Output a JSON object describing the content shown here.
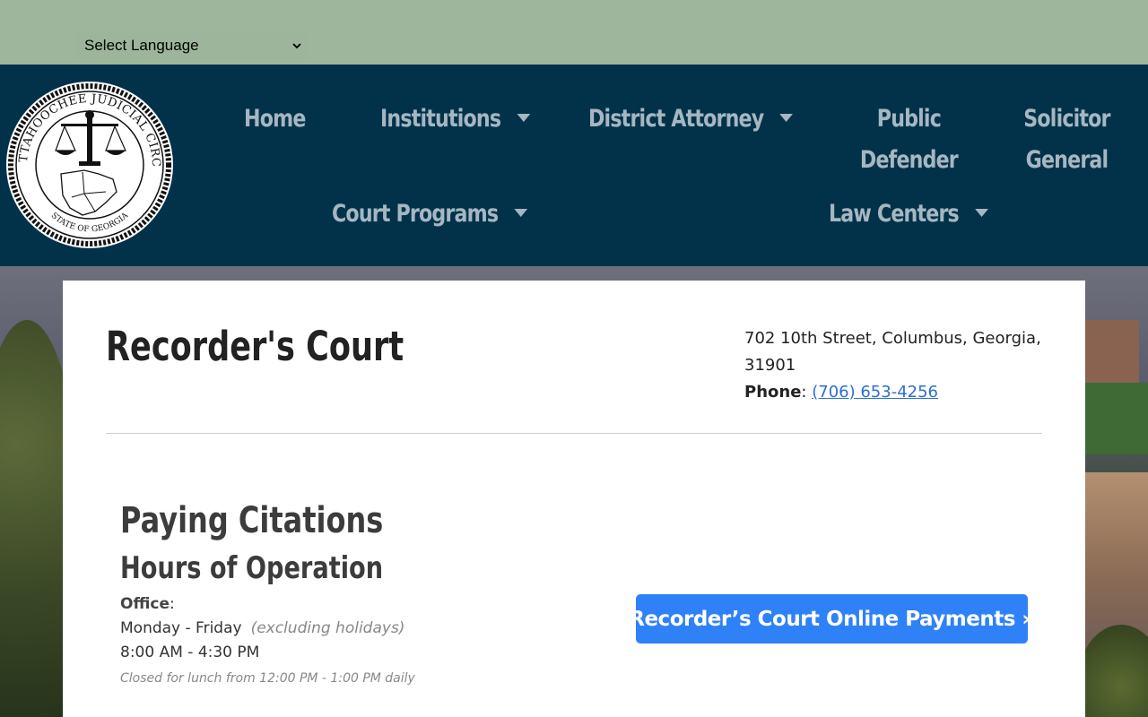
{
  "language": {
    "selected": "Select Language"
  },
  "header": {
    "seal_text_top": "CHATTAHOOCHEE JUDICIAL CIRCUIT",
    "seal_text_bottom": "STATE OF GEORGIA",
    "nav": [
      {
        "label": "Home",
        "dropdown": false
      },
      {
        "label": "Institutions",
        "dropdown": true
      },
      {
        "label": "District Attorney",
        "dropdown": true
      },
      {
        "label": "Public Defender",
        "dropdown": false
      },
      {
        "label": "Solicitor General",
        "dropdown": false
      },
      {
        "label": "Court Programs",
        "dropdown": true
      },
      {
        "label": "Law Centers",
        "dropdown": true
      }
    ]
  },
  "page": {
    "title": "Recorder's Court",
    "address_line": "702 10th Street, Columbus, Georgia, 31901",
    "phone_label": "Phone",
    "phone_separator": ":",
    "phone_number": "(706) 653-4256"
  },
  "section": {
    "title": "Paying Citations",
    "subtitle": "Hours of Operation",
    "office_label": "Office",
    "office_colon": ":",
    "days": "Monday - Friday",
    "days_note": "(excluding holidays)",
    "hours": "8:00 AM - 4:30 PM",
    "lunch": "Closed for lunch from 12:00 PM - 1:00 PM daily"
  },
  "cta": {
    "label": "Recorder’s Court Online Payments »"
  },
  "colors": {
    "nav_bg": "#01324a",
    "lang_bar": "#9eb79c",
    "button": "#2f81f7",
    "link": "#2e6fcf"
  }
}
